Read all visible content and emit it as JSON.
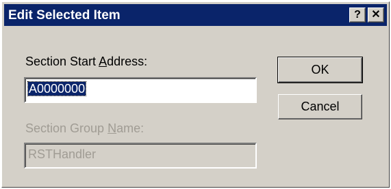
{
  "window": {
    "title": "Edit Selected Item",
    "help_label": "?",
    "close_label": "✕"
  },
  "form": {
    "start_address_label_pre": "Section Start ",
    "start_address_label_key": "A",
    "start_address_label_post": "ddress:",
    "start_address_value": "A0000000",
    "group_name_label_pre": "Section Group ",
    "group_name_label_key": "N",
    "group_name_label_post": "ame:",
    "group_name_value": "RSTHandler"
  },
  "buttons": {
    "ok_label": "OK",
    "cancel_label": "Cancel"
  }
}
